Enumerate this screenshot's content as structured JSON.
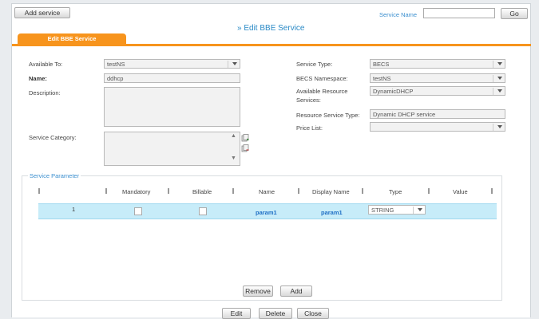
{
  "toolbar": {
    "add_service_label": "Add service",
    "search_label": "Service Name",
    "search_value": "",
    "go_label": "Go"
  },
  "page": {
    "title": "» Edit BBE Service",
    "tab_label": "Edit BBE Service"
  },
  "form": {
    "available_to": {
      "label": "Available To:",
      "value": "testNS"
    },
    "name": {
      "label": "Name:",
      "value": "ddhcp"
    },
    "description": {
      "label": "Description:",
      "value": ""
    },
    "service_category": {
      "label": "Service Category:",
      "value": ""
    },
    "service_type": {
      "label": "Service Type:",
      "value": "BECS"
    },
    "becs_namespace": {
      "label": "BECS Namespace:",
      "value": "testNS"
    },
    "available_resource_services": {
      "label": "Available Resource Services:",
      "value": "DynamicDHCP"
    },
    "resource_service_type": {
      "label": "Resource Service Type:",
      "value": "Dynamic DHCP service"
    },
    "price_list": {
      "label": "Price List:",
      "value": ""
    }
  },
  "params": {
    "legend": "Service Parameter",
    "columns": [
      "Mandatory",
      "Billable",
      "Name",
      "Display Name",
      "Type",
      "Value"
    ],
    "rows": [
      {
        "index": "1",
        "name": "param1",
        "display_name": "param1",
        "type": "STRING",
        "value": ""
      }
    ],
    "remove_label": "Remove",
    "add_label": "Add"
  },
  "footer": {
    "edit_label": "Edit",
    "delete_label": "Delete",
    "close_label": "Close"
  },
  "colors": {
    "accent": "#f7941d",
    "link": "#2a8ac6",
    "selected_row": "#c7ecf9"
  }
}
